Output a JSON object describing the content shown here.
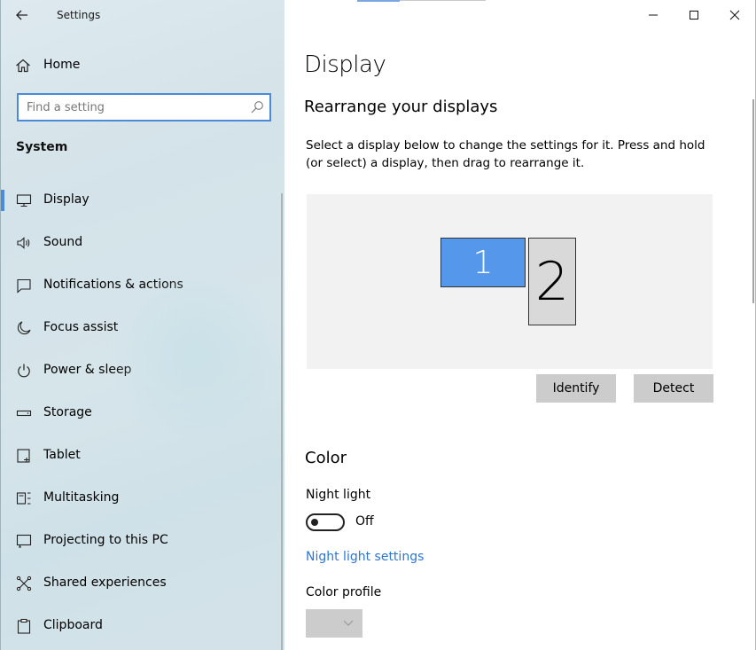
{
  "window": {
    "title": "Settings",
    "controls": {
      "minimize": "minimize",
      "maximize": "maximize",
      "close": "close"
    }
  },
  "sidebar": {
    "home_label": "Home",
    "search": {
      "placeholder": "Find a setting",
      "value": ""
    },
    "section_title": "System",
    "items": [
      {
        "label": "Display",
        "icon": "monitor-icon",
        "active": true
      },
      {
        "label": "Sound",
        "icon": "speaker-icon"
      },
      {
        "label": "Notifications & actions",
        "icon": "notification-icon"
      },
      {
        "label": "Focus assist",
        "icon": "moon-icon"
      },
      {
        "label": "Power & sleep",
        "icon": "power-icon"
      },
      {
        "label": "Storage",
        "icon": "storage-icon"
      },
      {
        "label": "Tablet",
        "icon": "tablet-icon"
      },
      {
        "label": "Multitasking",
        "icon": "multitasking-icon"
      },
      {
        "label": "Projecting to this PC",
        "icon": "projector-icon"
      },
      {
        "label": "Shared experiences",
        "icon": "shared-icon"
      },
      {
        "label": "Clipboard",
        "icon": "clipboard-icon"
      }
    ]
  },
  "main": {
    "page_title": "Display",
    "rearrange": {
      "title": "Rearrange your displays",
      "description": "Select a display below to change the settings for it. Press and hold (or select) a display, then drag to rearrange it.",
      "monitor1_label": "1",
      "monitor2_label": "2",
      "identify_label": "Identify",
      "detect_label": "Detect"
    },
    "color": {
      "title": "Color",
      "night_light_label": "Night light",
      "night_light_state": "Off",
      "night_light_on": false,
      "night_light_settings_link": "Night light settings",
      "color_profile_label": "Color profile",
      "color_profile_value": ""
    }
  },
  "colors": {
    "accent": "#4a8ad6",
    "link": "#2d76d2",
    "monitor_selected": "#5597ea",
    "monitor_other": "#d9d9d9",
    "button_bg": "#cccccc"
  }
}
